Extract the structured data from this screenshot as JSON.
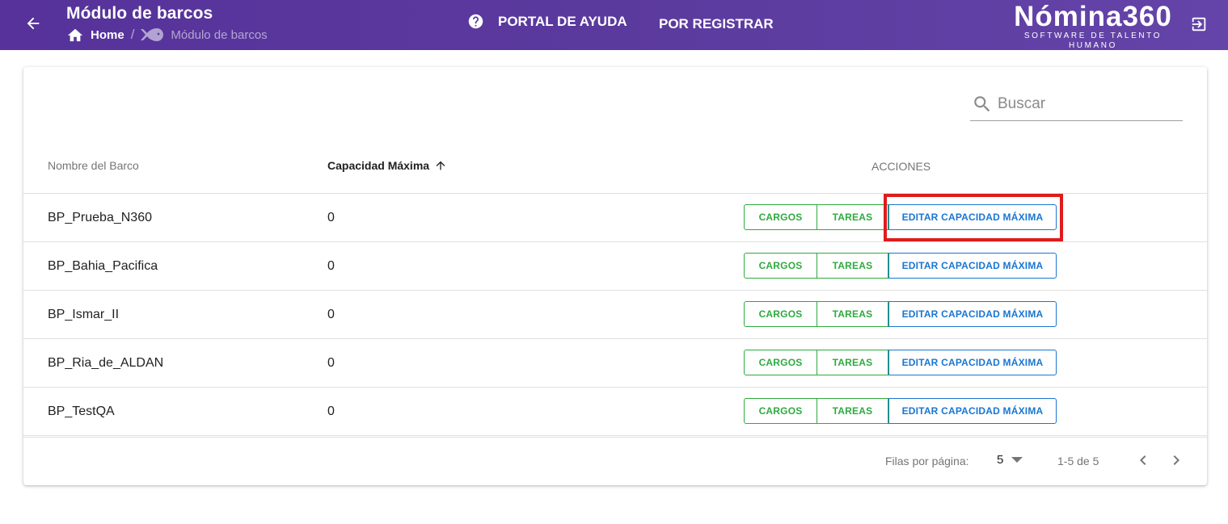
{
  "header": {
    "title": "Módulo de barcos",
    "breadcrumb": {
      "home": "Home",
      "current": "Módulo de barcos"
    },
    "help_link": "PORTAL DE AYUDA",
    "register_link": "POR REGISTRAR",
    "brand": {
      "name": "Nómina360",
      "tagline": "SOFTWARE DE TALENTO HUMANO"
    }
  },
  "search": {
    "placeholder": "Buscar"
  },
  "table": {
    "columns": {
      "name": "Nombre del Barco",
      "capacity": "Capacidad Máxima",
      "actions": "ACCIONES"
    },
    "action_labels": {
      "cargos": "CARGOS",
      "tareas": "TAREAS",
      "edit": "EDITAR CAPACIDAD MÁXIMA"
    },
    "rows": [
      {
        "name": "BP_Prueba_N360",
        "capacity": "0"
      },
      {
        "name": "BP_Bahia_Pacifica",
        "capacity": "0"
      },
      {
        "name": "BP_Ismar_II",
        "capacity": "0"
      },
      {
        "name": "BP_Ria_de_ALDAN",
        "capacity": "0"
      },
      {
        "name": "BP_TestQA",
        "capacity": "0"
      }
    ]
  },
  "pagination": {
    "rows_label": "Filas por página:",
    "rows_per_page": "5",
    "range": "1-5 de 5"
  },
  "colors": {
    "header_bg": "#5b3a9e",
    "action_green": "#2eaa3f",
    "action_blue": "#1976d2",
    "highlight_red": "#e01b1b"
  },
  "icons": [
    "arrow-left-icon",
    "home-icon",
    "fish-icon",
    "help-circle-icon",
    "logout-icon",
    "search-icon",
    "arrow-up-icon",
    "caret-down-icon",
    "chevron-left-icon",
    "chevron-right-icon"
  ]
}
